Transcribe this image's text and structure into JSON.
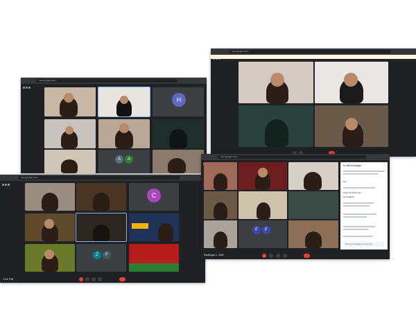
{
  "windows": [
    {
      "id": "a",
      "url": "meet.google.com/...",
      "time": "",
      "meeting": ""
    },
    {
      "id": "b",
      "url": "meet.google.com/...",
      "time": "",
      "meeting": ""
    },
    {
      "id": "c",
      "url": "meet.google.com/...",
      "time": "7:41 PM",
      "meeting": "Komunikasi Minggguan 4 - AN2"
    },
    {
      "id": "d",
      "url": "meet.google.com/...",
      "time": "",
      "meeting": "Rantingan 4 - AN2"
    }
  ],
  "avatars": {
    "H": "H",
    "A": "A",
    "A2": "A",
    "C": "C",
    "Z": "Z",
    "F": "F",
    "F1": "F",
    "F2": "F"
  },
  "chat": {
    "title": "In-call messages",
    "messages": [
      {
        "from": "",
        "text": "Hai"
      },
      {
        "from": "",
        "text": "Gadis Ari Rachman"
      },
      {
        "from": "",
        "text": "Terimakasih"
      },
      {
        "from": "",
        "text": ""
      },
      {
        "from": "",
        "text": ""
      }
    ],
    "input_placeholder": "Send a message to everyone"
  },
  "colors": {
    "accent_red": "#ea4335",
    "av_blue": "#5c6bc0",
    "av_teal": "#26a69a",
    "av_purple": "#ab47bc",
    "av_indigo": "#3949ab"
  }
}
